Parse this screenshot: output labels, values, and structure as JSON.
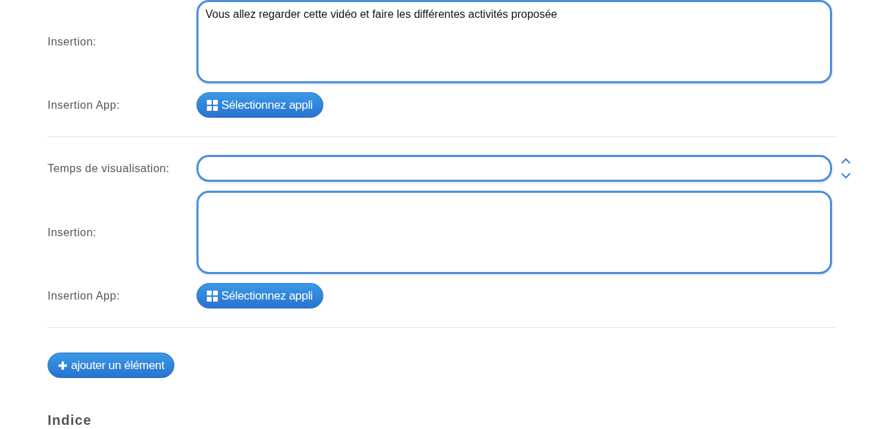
{
  "sections": [
    {
      "rows": [
        {
          "kind": "textarea",
          "label": "Insertion:",
          "value": "Vous allez regarder cette vidéo et faire les différentes activités proposée"
        },
        {
          "kind": "app",
          "label": "Insertion App:",
          "button": "Sélectionnez appli"
        }
      ]
    },
    {
      "rows": [
        {
          "kind": "number",
          "label": "Temps de visualisation:"
        },
        {
          "kind": "textarea",
          "label": "Insertion:"
        },
        {
          "kind": "app",
          "label": "Insertion App:",
          "button": "Sélectionnez appli"
        }
      ]
    }
  ],
  "add_button": "ajouter un élément",
  "heading": "Indice"
}
